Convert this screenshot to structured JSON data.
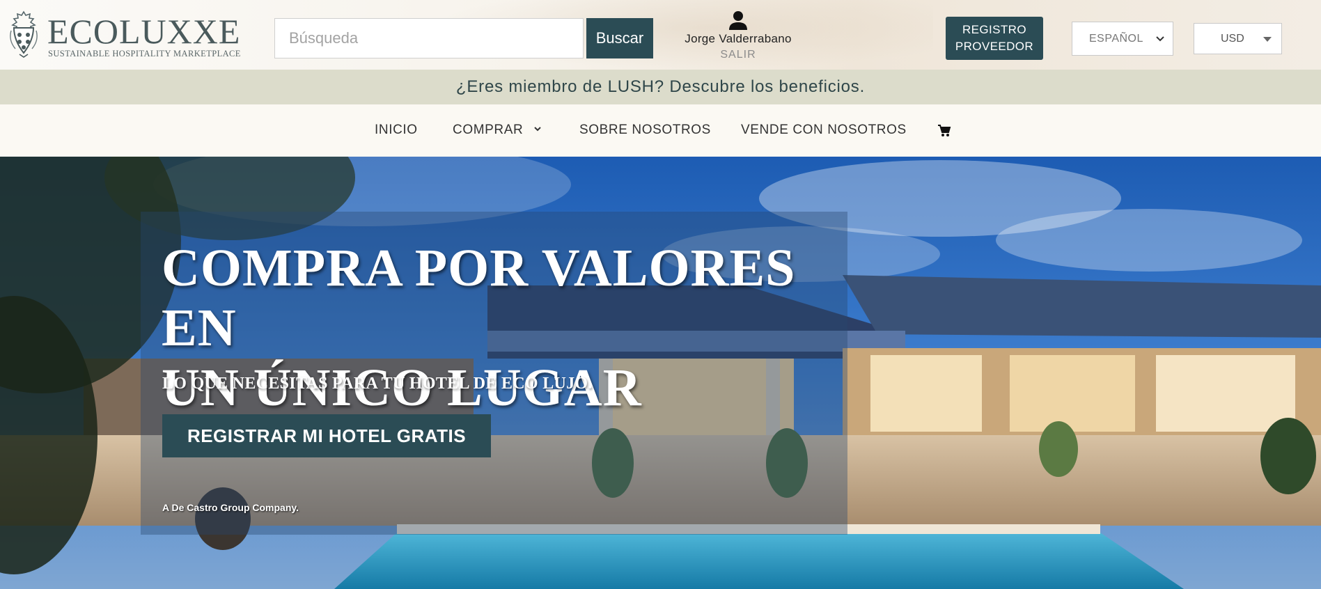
{
  "brand": {
    "name": "ECOLUXXE",
    "tagline": "SUSTAINABLE HOSPITALITY MARKETPLACE"
  },
  "search": {
    "placeholder": "Búsqueda",
    "button_label": "Buscar"
  },
  "user": {
    "name": "Jorge Valderrabano",
    "logout_label": "SALIR"
  },
  "vendor_button": {
    "line1": "REGISTRO",
    "line2": "PROVEEDOR"
  },
  "language": {
    "selected": "ESPAÑOL"
  },
  "currency": {
    "selected": "USD"
  },
  "promo": {
    "text": "¿Eres miembro de LUSH? Descubre los beneficios."
  },
  "nav": {
    "items": [
      {
        "label": "INICIO"
      },
      {
        "label": "COMPRAR"
      },
      {
        "label": "SOBRE NOSOTROS"
      },
      {
        "label": "VENDE CON NOSOTROS"
      }
    ]
  },
  "hero": {
    "title_line1": "COMPRA POR VALORES EN",
    "title_line2": "UN ÚNICO LUGAR",
    "subtitle": "LO QUE NECESITAS PARA TU HOTEL DE ECO LUJO.",
    "cta_label": "REGISTRAR MI HOTEL GRATIS",
    "note": "A De Castro Group Company."
  },
  "icons": {
    "logo": "crest-icon",
    "user": "user-icon",
    "language_dropdown": "chevron-down-icon",
    "currency_dropdown": "caret-down-icon",
    "comprar_dropdown": "chevron-down-icon",
    "cart": "cart-icon"
  },
  "colors": {
    "primary": "#2b4c55",
    "promo_bg": "#dcdccb",
    "nav_bg": "#fbf9f3"
  }
}
